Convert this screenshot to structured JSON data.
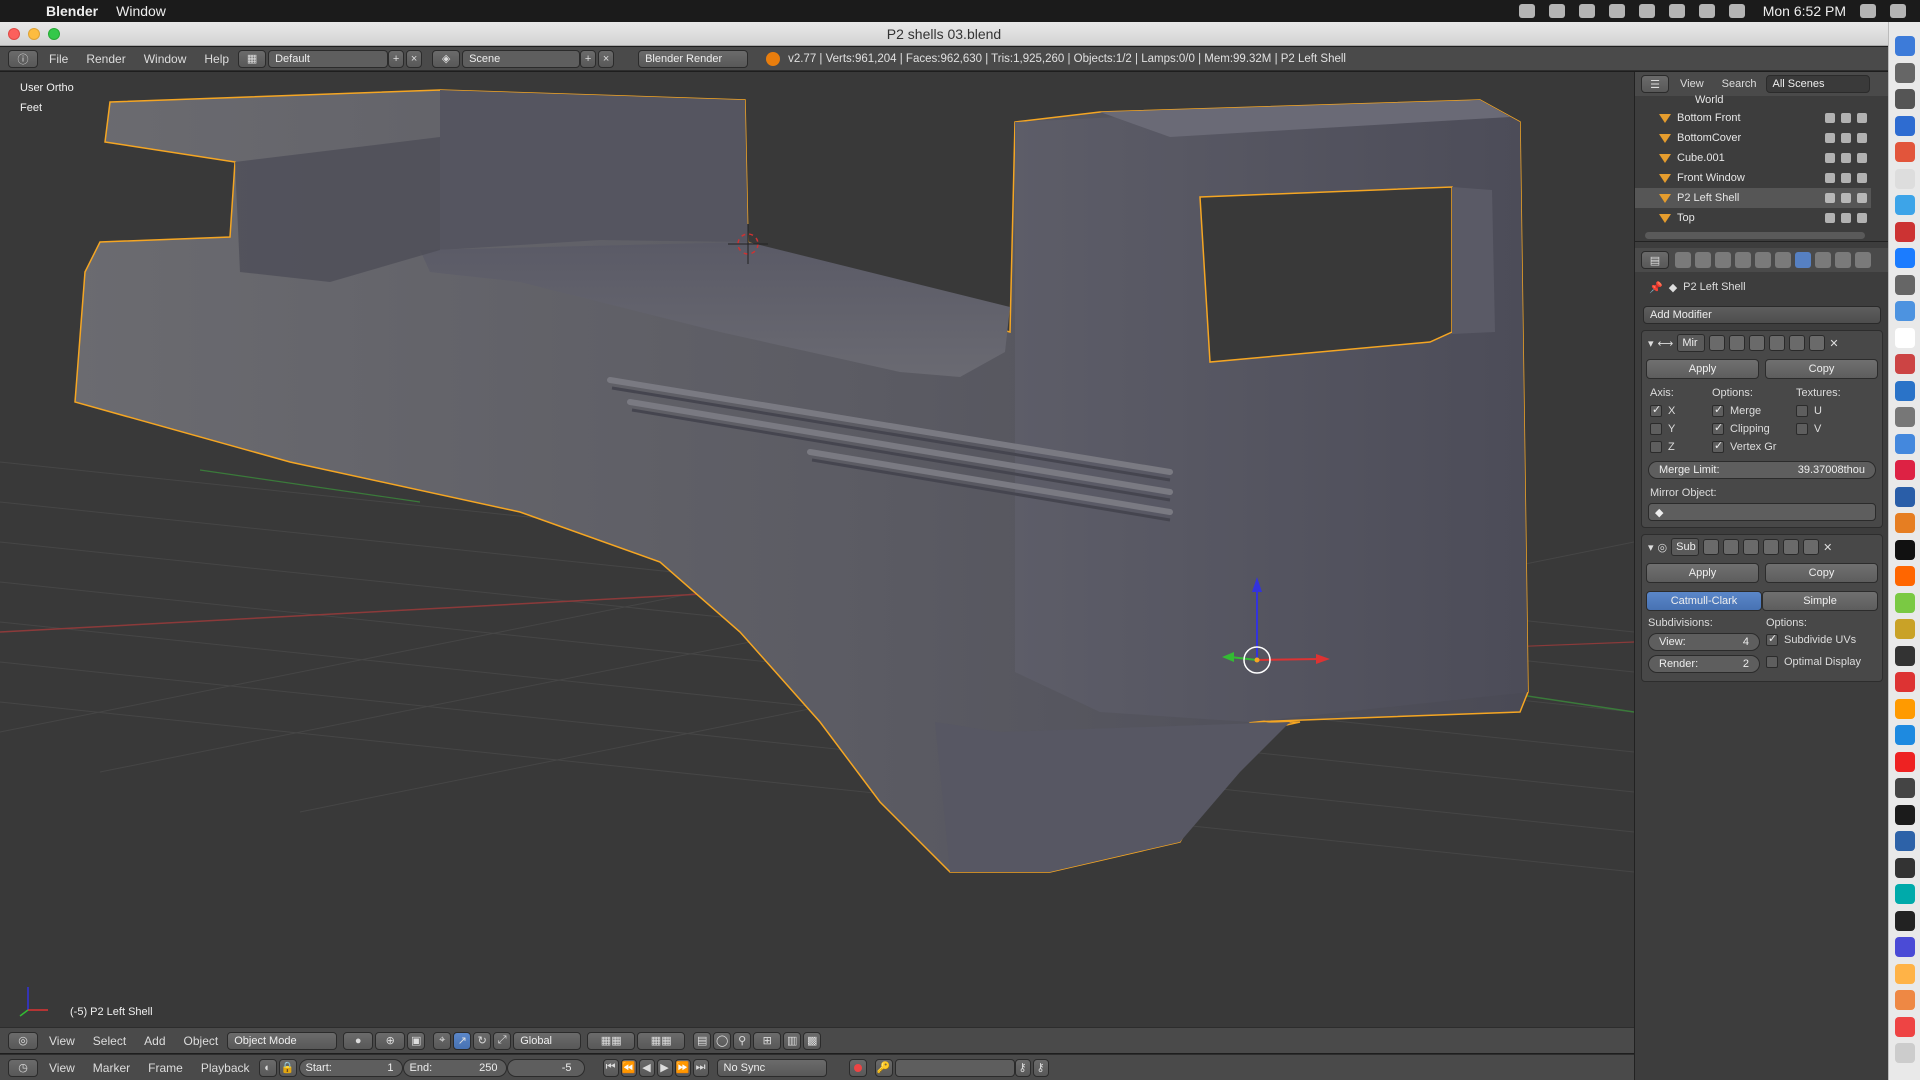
{
  "mac": {
    "app_name": "Blender",
    "menu_window": "Window",
    "clock": "Mon 6:52 PM"
  },
  "window": {
    "title": "P2 shells 03.blend"
  },
  "info_header": {
    "menus": [
      "File",
      "Render",
      "Window",
      "Help"
    ],
    "screen_layout": "Default",
    "scene": "Scene",
    "render_engine": "Blender Render",
    "stats": "v2.77 | Verts:961,204 | Faces:962,630 | Tris:1,925,260 | Objects:1/2 | Lamps:0/0 | Mem:99.32M | P2 Left Shell"
  },
  "viewport": {
    "view_name": "User Ortho",
    "units": "Feet",
    "object_label": "(-5) P2 Left Shell"
  },
  "view3d_header": {
    "menus": [
      "View",
      "Select",
      "Add",
      "Object"
    ],
    "mode": "Object Mode",
    "orientation": "Global"
  },
  "timeline_header": {
    "menus": [
      "View",
      "Marker",
      "Frame",
      "Playback"
    ],
    "start_label": "Start:",
    "start_value": "1",
    "end_label": "End:",
    "end_value": "250",
    "current_frame": "-5",
    "sync": "No Sync"
  },
  "outliner": {
    "menus": [
      "View",
      "Search"
    ],
    "scope": "All Scenes",
    "items": [
      "World",
      "Bottom Front",
      "BottomCover",
      "Cube.001",
      "Front Window",
      "P2 Left Shell",
      "Top"
    ]
  },
  "properties": {
    "object_name": "P2 Left Shell",
    "add_modifier": "Add Modifier",
    "mirror": {
      "name": "Mir",
      "apply": "Apply",
      "copy": "Copy",
      "axis_label": "Axis:",
      "options_label": "Options:",
      "textures_label": "Textures:",
      "axis": [
        "X",
        "Y",
        "Z"
      ],
      "options": [
        "Merge",
        "Clipping",
        "Vertex Gr"
      ],
      "textures": [
        "U",
        "V"
      ],
      "merge_limit_label": "Merge Limit:",
      "merge_limit_value": "39.37008thou",
      "mirror_object_label": "Mirror Object:"
    },
    "subsurf": {
      "name": "Sub",
      "apply": "Apply",
      "copy": "Copy",
      "catmull": "Catmull-Clark",
      "simple": "Simple",
      "subdivisions_label": "Subdivisions:",
      "options_label": "Options:",
      "view_label": "View:",
      "view_value": "4",
      "render_label": "Render:",
      "render_value": "2",
      "subdivide_uvs": "Subdivide UVs",
      "optimal_display": "Optimal Display"
    }
  },
  "dock_colors": [
    "#3d7bd9",
    "#666",
    "#555",
    "#2e6cd1",
    "#e2553b",
    "#ddd",
    "#3da4e8",
    "#c33",
    "#1b7cff",
    "#666",
    "#4d93e0",
    "#fff",
    "#c44",
    "#2a73c8",
    "#777",
    "#4488dd",
    "#d24",
    "#2a5ea8",
    "#e67e22",
    "#111",
    "#f60",
    "#7ac943",
    "#c9a227",
    "#333",
    "#d33",
    "#ff9a00",
    "#1e8ae0",
    "#e22",
    "#444",
    "#1b1b1b",
    "#2d62a8",
    "#333",
    "#0aa",
    "#222",
    "#4b4bd6",
    "#ffb347",
    "#e84",
    "#e44",
    "#ccc"
  ]
}
